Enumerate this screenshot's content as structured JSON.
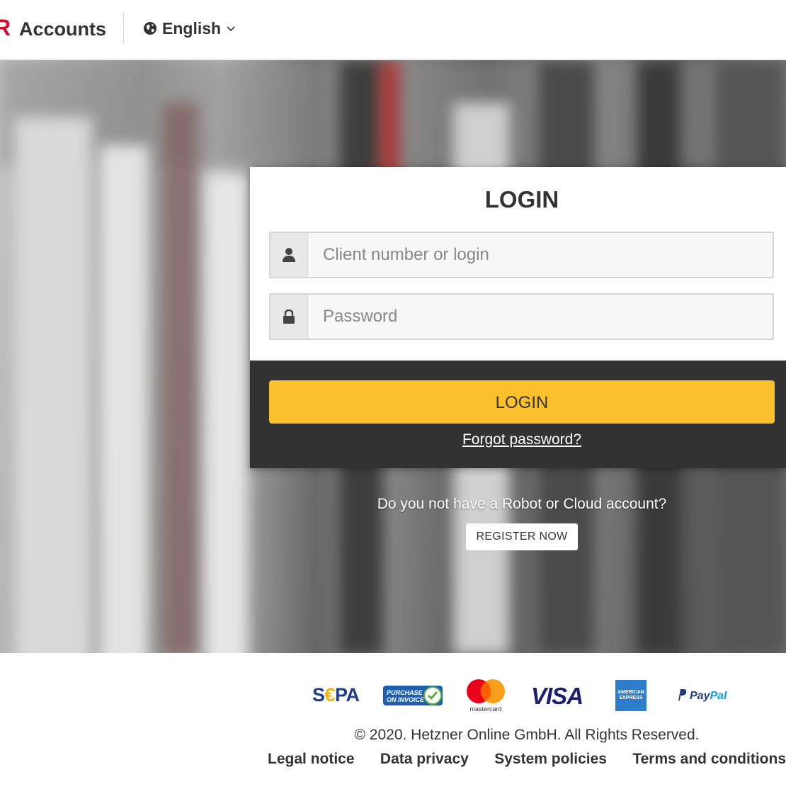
{
  "header": {
    "logo_mark": "R",
    "brand": "Accounts",
    "language": "English",
    "language_icon": "globe-icon",
    "language_chevron": "chevron-down-icon"
  },
  "login": {
    "title": "LOGIN",
    "username_placeholder": "Client number or login",
    "username_value": "",
    "username_icon": "user-icon",
    "password_placeholder": "Password",
    "password_value": "",
    "password_icon": "lock-icon",
    "submit_label": "LOGIN",
    "forgot_label": "Forgot password?"
  },
  "register": {
    "prompt": "Do you not have a Robot or Cloud account?",
    "button_label": "REGISTER NOW"
  },
  "payments": {
    "sepa_prefix": "S",
    "sepa_euro": "€",
    "sepa_suffix": "PA",
    "invoice_line1": "PURCHASE",
    "invoice_line2": "ON INVOICE",
    "mastercard": "mastercard",
    "visa": "VISA",
    "amex_line1": "AMERICAN",
    "amex_line2": "EXPRESS",
    "paypal_1": "Pay",
    "paypal_2": "Pal"
  },
  "footer": {
    "copyright": "© 2020. Hetzner Online GmbH. All Rights Reserved.",
    "links": [
      "Legal notice",
      "Data privacy",
      "System policies",
      "Terms and conditions"
    ]
  },
  "colors": {
    "accent": "#fbc02d",
    "brand_red": "#d50c2d",
    "card_dark": "#323232"
  }
}
